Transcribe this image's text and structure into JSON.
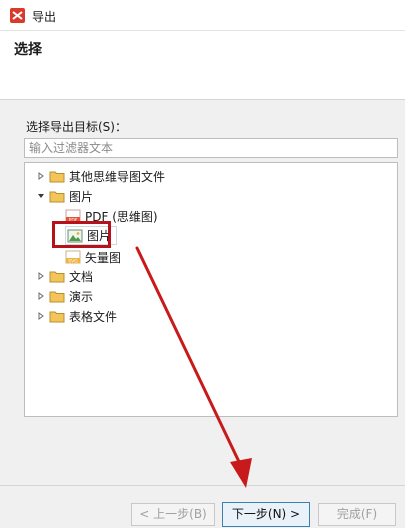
{
  "window": {
    "title": "导出"
  },
  "header": {
    "title": "选择"
  },
  "export_target": {
    "label": "选择导出目标(S)：",
    "filter_placeholder": "输入过滤器文本"
  },
  "tree": {
    "other_mindmap": "其他思维导图文件",
    "image_folder": "图片",
    "pdf_mindmap": "PDF (思维图)",
    "image_item": "图片",
    "vector": "矢量图",
    "document": "文档",
    "presentation": "演示",
    "spreadsheet": "表格文件",
    "pdf_icon_text": "PDF",
    "svg_icon_text": "SVG"
  },
  "buttons": {
    "back": "< 上一步(B)",
    "next": "下一步(N) >",
    "finish": "完成(F)"
  },
  "colors": {
    "annotation_red": "#b5121b",
    "folder_yellow": "#f2c45a",
    "app_red": "#d93a2b"
  },
  "icons": {
    "app": "xmind-icon",
    "folder": "folder-icon",
    "collapsed": "triangle-right-icon",
    "expanded": "triangle-down-icon",
    "pdf": "pdf-file-icon",
    "image": "image-file-icon",
    "svg": "svg-file-icon"
  }
}
